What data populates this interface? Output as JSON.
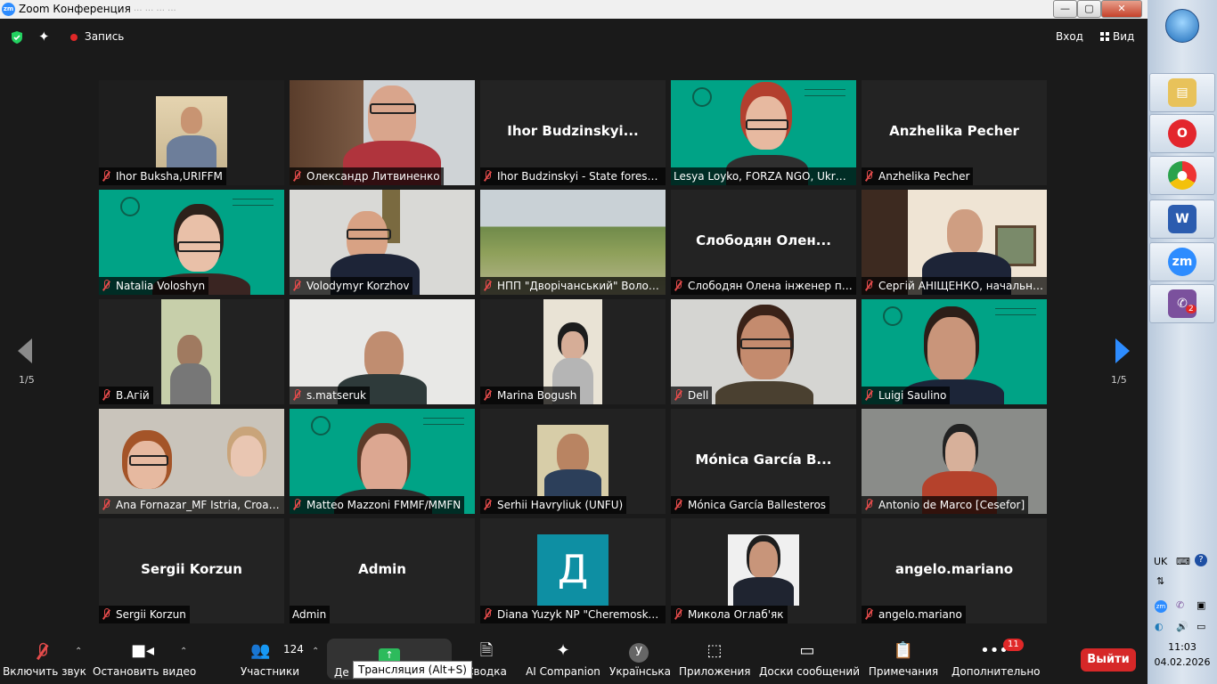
{
  "window": {
    "title": "Zoom Конференция",
    "logo": "zm",
    "ghost_tabs": "... ... ... ..."
  },
  "topbar": {
    "record_label": "Запись",
    "exit_label": "Вход",
    "view_label": "Вид"
  },
  "pagination": {
    "left": "1/5",
    "right": "1/5"
  },
  "participants": [
    {
      "name": "Ihor Buksha,URIFFM",
      "muted": true,
      "video": true
    },
    {
      "name": "Олександр Литвиненко",
      "muted": true,
      "video": true
    },
    {
      "name": "Ihor Budzinskyi - State forest ...",
      "big": "Ihor  Budzinskyi...",
      "muted": true,
      "video": false
    },
    {
      "name": "Lesya Loyko, FORZA NGO, Ukraine",
      "muted": false,
      "video": true,
      "active": true
    },
    {
      "name": "Anzhelika Pecher",
      "big": "Anzhelika Pecher",
      "muted": true,
      "video": false
    },
    {
      "name": "Natalia Voloshyn",
      "muted": true,
      "video": true
    },
    {
      "name": "Volodymyr Korzhov",
      "muted": true,
      "video": true
    },
    {
      "name": "НПП \"Дворічанський\" Волод...",
      "muted": true,
      "video": true
    },
    {
      "name": "Слободян Олена інженер по...",
      "big": "Слободян  Олен...",
      "muted": true,
      "video": false
    },
    {
      "name": "Сергій АНІЩЕНКО, начальни...",
      "muted": true,
      "video": true
    },
    {
      "name": "В.Агій",
      "muted": true,
      "video": true
    },
    {
      "name": "s.matseruk",
      "muted": true,
      "video": true
    },
    {
      "name": "Marina Bogush",
      "muted": true,
      "video": true
    },
    {
      "name": "Dell",
      "muted": true,
      "video": true
    },
    {
      "name": "Luigi Saulino",
      "muted": true,
      "video": true
    },
    {
      "name": "Ana Fornazar_MF Istria, Croatia",
      "muted": true,
      "video": true
    },
    {
      "name": "Matteo Mazzoni FMMF/MMFN",
      "muted": true,
      "video": true
    },
    {
      "name": "Serhii Havryliuk (UNFU)",
      "muted": true,
      "video": true
    },
    {
      "name": "Mónica García Ballesteros",
      "big": "Mónica  García  B...",
      "muted": true,
      "video": false
    },
    {
      "name": "Antonio de Marco [Cesefor]",
      "muted": true,
      "video": true
    },
    {
      "name": "Sergii Korzun",
      "big": "Sergii Korzun",
      "muted": true,
      "video": false
    },
    {
      "name": "Admin",
      "big": "Admin",
      "muted": false,
      "video": false
    },
    {
      "name": "Diana Yuzyk NP \"Cheremoskyi\"",
      "muted": true,
      "video": false,
      "avatar_letter": "Д"
    },
    {
      "name": "Микола Оглаб'як",
      "muted": true,
      "video": true
    },
    {
      "name": "angelo.mariano",
      "big": "angelo.mariano",
      "muted": true,
      "video": false
    }
  ],
  "toolbar": {
    "unmute": "Включить звук",
    "stop_video": "Остановить видео",
    "participants": "Участники",
    "participants_count": "124",
    "share": "Де",
    "share_tooltip": "Трансляция (Alt+S)",
    "summary": "Сводка",
    "ai": "AI Companion",
    "language": "Українська",
    "language_icon": "У",
    "apps": "Приложения",
    "whiteboards": "Доски сообщений",
    "notes": "Примечания",
    "more": "Дополнительно",
    "more_badge": "11",
    "leave": "Выйти"
  },
  "taskbar": {
    "lang": "UK",
    "time": "11:03",
    "date": "04.02.2026",
    "viber_badge": "2",
    "word_letter": "W",
    "zoom_letter": "zm"
  }
}
